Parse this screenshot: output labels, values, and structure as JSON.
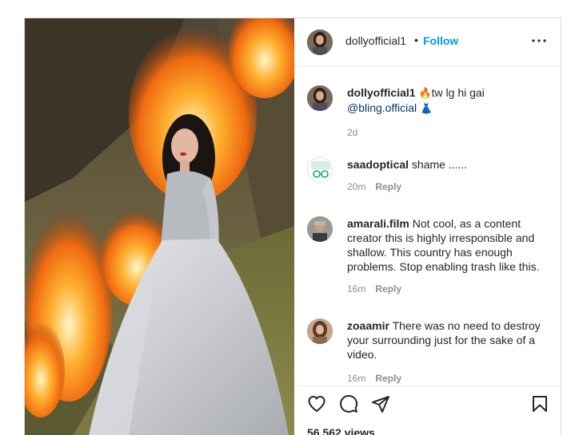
{
  "post": {
    "username": "dollyofficial1",
    "follow_label": "Follow",
    "separator": "•",
    "caption": {
      "username": "dollyofficial1",
      "emoji_fire": "🔥",
      "text": "tw lg hi gai",
      "mention": "@bling.official",
      "emoji_dress": "👗",
      "time": "2d"
    },
    "comments": [
      {
        "username": "saadoptical",
        "text": "shame ......",
        "time": "20m",
        "reply": "Reply"
      },
      {
        "username": "amarali.film",
        "text": "Not cool, as a content creator this is highly irresponsible and shallow. This country has enough problems. Stop enabling trash like this.",
        "time": "16m",
        "reply": "Reply"
      },
      {
        "username": "zoaamir",
        "text": "There was no need to destroy your surrounding just for the sake of a video.",
        "time": "16m",
        "reply": "Reply"
      }
    ],
    "views": "56,562 views"
  },
  "icons": {
    "more": "more-options-icon",
    "like": "heart-icon",
    "comment": "comment-icon",
    "share": "share-icon",
    "save": "bookmark-icon"
  },
  "colors": {
    "accent": "#0095f6",
    "text": "#262626",
    "muted": "#8e8e8e",
    "border": "#dbdbdb"
  }
}
